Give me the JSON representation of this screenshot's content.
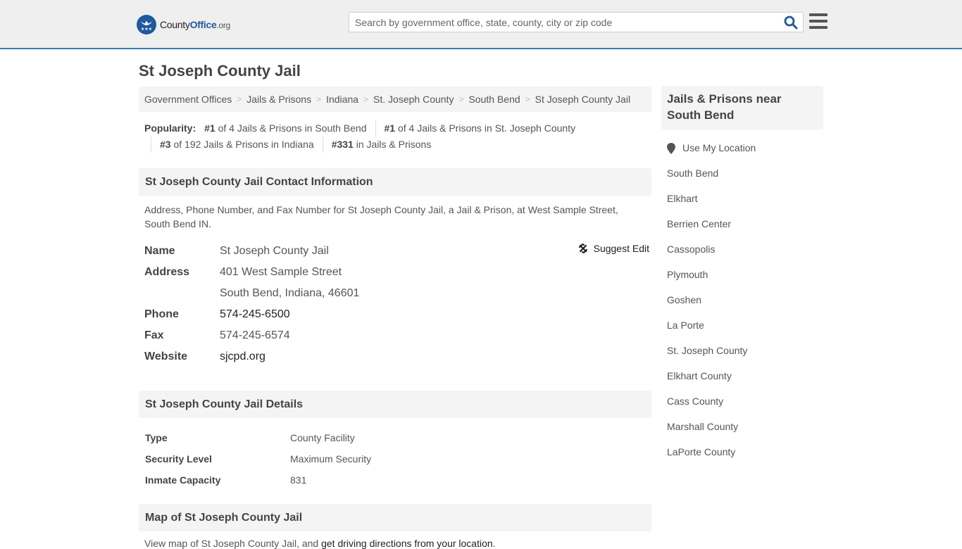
{
  "header": {
    "logo": {
      "county": "County",
      "office": "Office",
      "org": ".org"
    },
    "search_placeholder": "Search by government office, state, county, city or zip code",
    "search_value": ""
  },
  "page_title": "St Joseph County Jail",
  "breadcrumb": [
    "Government Offices",
    "Jails & Prisons",
    "Indiana",
    "St. Joseph County",
    "South Bend",
    "St Joseph County Jail"
  ],
  "popularity": {
    "label": "Popularity:",
    "items": [
      {
        "rank": "#1",
        "text": " of 4 Jails & Prisons in South Bend"
      },
      {
        "rank": "#1",
        "text": " of 4 Jails & Prisons in St. Joseph County"
      },
      {
        "rank": "#3",
        "text": " of 192 Jails & Prisons in Indiana"
      },
      {
        "rank": "#331",
        "text": " in Jails & Prisons"
      }
    ]
  },
  "contact": {
    "heading": "St Joseph County Jail Contact Information",
    "description": "Address, Phone Number, and Fax Number for St Joseph County Jail, a Jail & Prison, at West Sample Street, South Bend IN.",
    "suggest_edit": "Suggest Edit",
    "fields": {
      "name_label": "Name",
      "name": "St Joseph County Jail",
      "address_label": "Address",
      "address_line1": "401 West Sample Street",
      "address_line2": "South Bend, Indiana, 46601",
      "phone_label": "Phone",
      "phone": "574-245-6500",
      "fax_label": "Fax",
      "fax": "574-245-6574",
      "website_label": "Website",
      "website": "sjcpd.org"
    }
  },
  "details": {
    "heading": "St Joseph County Jail Details",
    "rows": [
      {
        "label": "Type",
        "value": "County Facility"
      },
      {
        "label": "Security Level",
        "value": "Maximum Security"
      },
      {
        "label": "Inmate Capacity",
        "value": "831"
      }
    ]
  },
  "map": {
    "heading": "Map of St Joseph County Jail",
    "text_before": "View map of St Joseph County Jail, and ",
    "link": "get driving directions from your location",
    "text_after": "."
  },
  "sidebar": {
    "heading": "Jails & Prisons near South Bend",
    "use_location": "Use My Location",
    "links": [
      "South Bend",
      "Elkhart",
      "Berrien Center",
      "Cassopolis",
      "Plymouth",
      "Goshen",
      "La Porte",
      "St. Joseph County",
      "Elkhart County",
      "Cass County",
      "Marshall County",
      "LaPorte County"
    ]
  },
  "colors": {
    "brand": "#1e5a9c",
    "accent_border": "#3a7bad"
  }
}
